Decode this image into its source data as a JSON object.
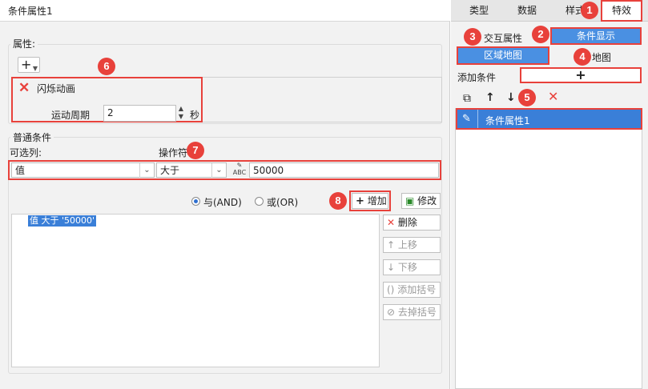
{
  "dialog": {
    "title": "条件属性1",
    "attributes": {
      "group_label": "属性:",
      "add_button": "+",
      "effect_name": "闪烁动画",
      "period_label": "运动周期",
      "period_value": "2",
      "period_unit": "秒"
    },
    "conditions": {
      "group_label": "普通条件",
      "column_label": "可选列:",
      "operator_label": "操作符",
      "column_value": "值",
      "operator_value": "大于",
      "value_input": "50000",
      "radio_and": "与(AND)",
      "radio_or": "或(OR)",
      "add_button": "增加",
      "modify_button": "修改",
      "list_item": "值 大于 '50000'",
      "delete_button": "删除",
      "up_button": "上移",
      "down_button": "下移",
      "add_bracket_button": "添加括号",
      "remove_bracket_button": "去掉括号"
    }
  },
  "panel": {
    "tabs": [
      "类型",
      "数据",
      "样式",
      "特效"
    ],
    "interactive_attr_label": "交互属性",
    "condition_display_button": "条件显示",
    "region_map_button": "区域地图",
    "other_map_button": "地图",
    "add_condition_label": "添加条件",
    "add_condition_button": "+",
    "condition_item": "条件属性1"
  },
  "callouts": [
    "1",
    "2",
    "3",
    "4",
    "5",
    "6",
    "7",
    "8"
  ],
  "colors": {
    "accent_blue": "#4a90e2",
    "callout_red": "#e8413b",
    "selection_blue": "#3a7fd8"
  }
}
